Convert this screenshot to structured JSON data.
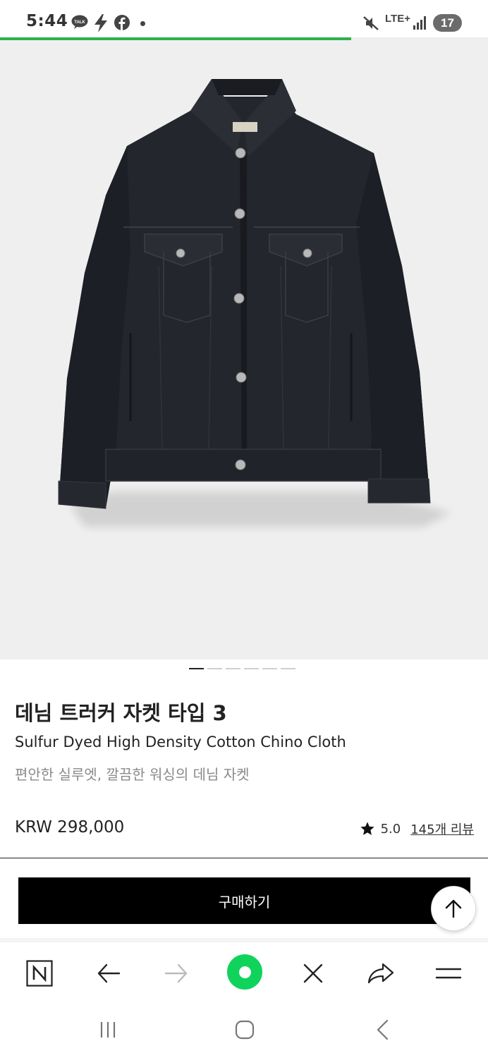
{
  "status_bar": {
    "time": "5:44",
    "network": "LTE+",
    "battery": "17",
    "icons": [
      "kakaotalk-icon",
      "bolt-icon",
      "facebook-icon",
      "dot-icon",
      "mute-icon",
      "signal-icon"
    ]
  },
  "page_load_progress": 0.72,
  "product": {
    "image_alt": "dark denim trucker jacket",
    "carousel": {
      "count": 6,
      "active_index": 0
    },
    "title": "데님 트러커 자켓 타입 3",
    "subtitle": "Sulfur Dyed High Density Cotton Chino Cloth",
    "description": "편안한 실루엣, 깔끔한 워싱의 데님 자켓",
    "price": "KRW 298,000",
    "rating": "5.0",
    "review_link": "145개 리뷰"
  },
  "buy_button_label": "구매하기",
  "browser_toolbar": {
    "items": [
      "naver-home-icon",
      "back-arrow-icon",
      "forward-arrow-icon",
      "green-circle-icon",
      "close-icon",
      "share-icon",
      "menu-icon"
    ]
  },
  "android_nav": {
    "items": [
      "recent-apps-icon",
      "home-icon",
      "back-icon"
    ]
  },
  "colors": {
    "progress": "#2bb24c",
    "green_button": "#10d35c",
    "buy_button": "#000000",
    "image_bg": "#efefef"
  }
}
